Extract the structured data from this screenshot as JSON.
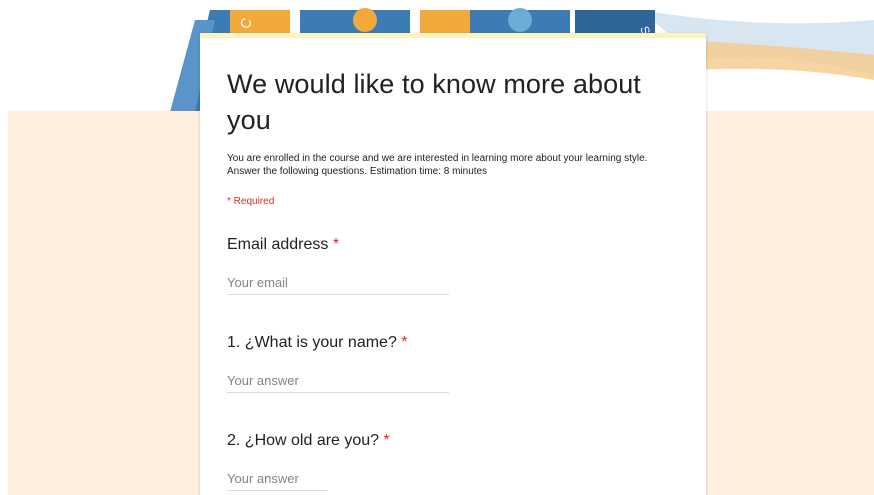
{
  "form": {
    "title": "We would like to know more about you",
    "description_line1": "You are enrolled in the course and we are interested in learning more about your learning style.",
    "description_line2": "Answer the following questions. Estimation time: 8 minutes",
    "required_note": "* Required",
    "questions": [
      {
        "label": "Email address",
        "required_mark": "*",
        "placeholder": "Your email"
      },
      {
        "label": "1. ¿What is your name?",
        "required_mark": "*",
        "placeholder": "Your answer"
      },
      {
        "label": "2. ¿How old are you?",
        "required_mark": "*",
        "placeholder": "Your answer"
      }
    ]
  },
  "colors": {
    "accent_bar": "#fdf3c2",
    "background": "#fdeedd",
    "required": "#d93025",
    "banner_blue": "#3d7bb5",
    "banner_orange": "#f2a93b"
  }
}
